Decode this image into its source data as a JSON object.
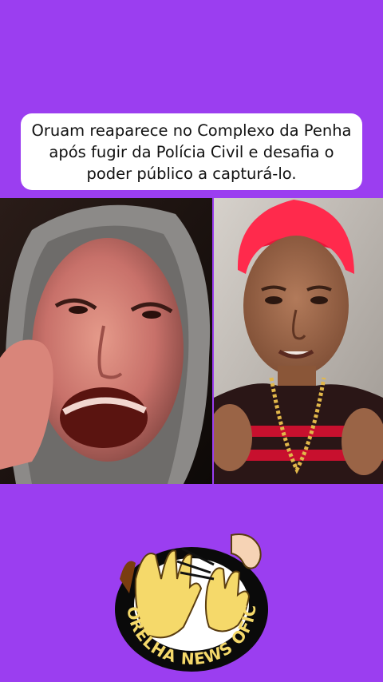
{
  "headline": {
    "text": "Oruam reaparece no Complexo da Penha após fugir da Polícia Civil e desafia o poder público a capturá-lo."
  },
  "photos": {
    "left": {
      "description_icon": "person-hooded-selfie-image"
    },
    "right": {
      "description_icon": "person-red-hair-image"
    }
  },
  "logo": {
    "text": "NA ORELHA NEWS OFICIAL",
    "icon": "hands-whisper-logo"
  },
  "colors": {
    "background": "#9b3ef0",
    "card": "#ffffff",
    "logo_ring": "#0a0a0a",
    "logo_hands": "#f5d96a"
  }
}
